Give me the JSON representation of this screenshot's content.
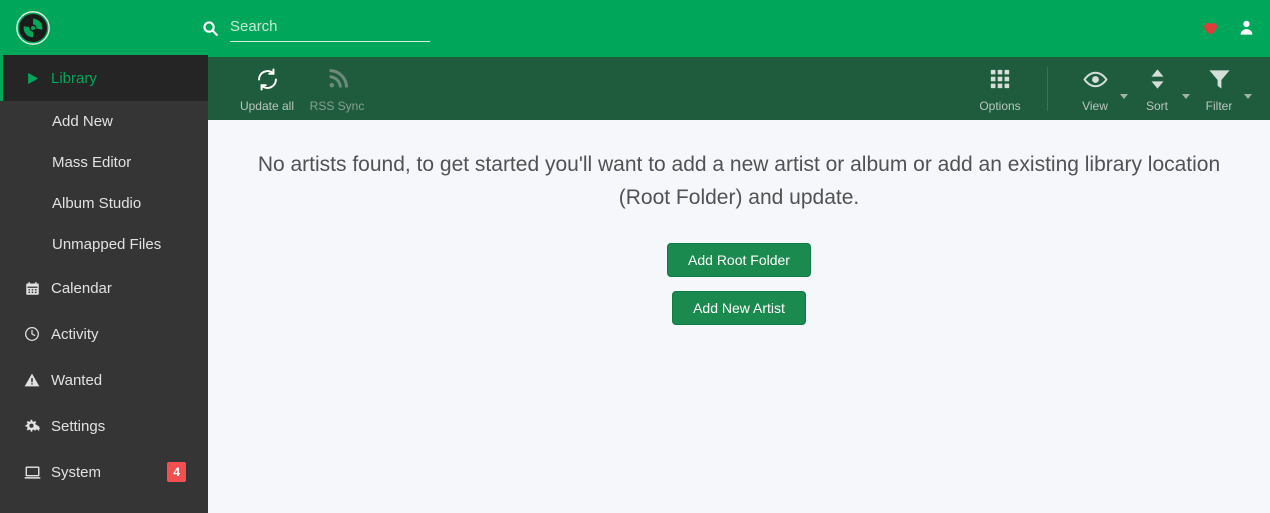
{
  "header": {
    "logo_icon": "lidarr-logo-icon",
    "search": {
      "icon": "search-icon",
      "placeholder": "Search",
      "value": ""
    },
    "actions": [
      {
        "name": "donate-heart-icon",
        "label": "Donate",
        "color": "#e23b3b"
      },
      {
        "name": "user-account-icon",
        "label": "Account",
        "color": "#ffffff"
      }
    ],
    "background_color": "#00a65a"
  },
  "sidebar": {
    "background_color": "#353535",
    "active_color": "#00a65a",
    "items": [
      {
        "label": "Library",
        "icon": "play-icon",
        "active": true
      },
      {
        "label": "Calendar",
        "icon": "calendar-icon",
        "active": false
      },
      {
        "label": "Activity",
        "icon": "clock-icon",
        "active": false
      },
      {
        "label": "Wanted",
        "icon": "warning-triangle-icon",
        "active": false
      },
      {
        "label": "Settings",
        "icon": "gears-icon",
        "active": false
      },
      {
        "label": "System",
        "icon": "monitor-icon",
        "active": false,
        "badge": "4",
        "badge_color": "#f05050"
      }
    ],
    "library_children": [
      {
        "label": "Add New"
      },
      {
        "label": "Mass Editor"
      },
      {
        "label": "Album Studio"
      },
      {
        "label": "Unmapped Files"
      }
    ]
  },
  "toolbar": {
    "background_color": "#1f5c3d",
    "left_actions": [
      {
        "label": "Update all",
        "icon": "refresh-icon",
        "disabled": false
      },
      {
        "label": "RSS Sync",
        "icon": "rss-icon",
        "disabled": true
      }
    ],
    "right_actions": [
      {
        "label": "Options",
        "icon": "grid-icon",
        "has_caret": false
      },
      {
        "label": "View",
        "icon": "eye-icon",
        "has_caret": true
      },
      {
        "label": "Sort",
        "icon": "sort-arrows-icon",
        "has_caret": true
      },
      {
        "label": "Filter",
        "icon": "filter-funnel-icon",
        "has_caret": true
      }
    ]
  },
  "main": {
    "background_color": "#f5f7fa",
    "empty_message": "No artists found, to get started you'll want to add a new artist or album or add an existing library location (Root Folder) and update.",
    "buttons": [
      {
        "label": "Add Root Folder",
        "color": "#1a8a4e"
      },
      {
        "label": "Add New Artist",
        "color": "#1a8a4e"
      }
    ]
  }
}
